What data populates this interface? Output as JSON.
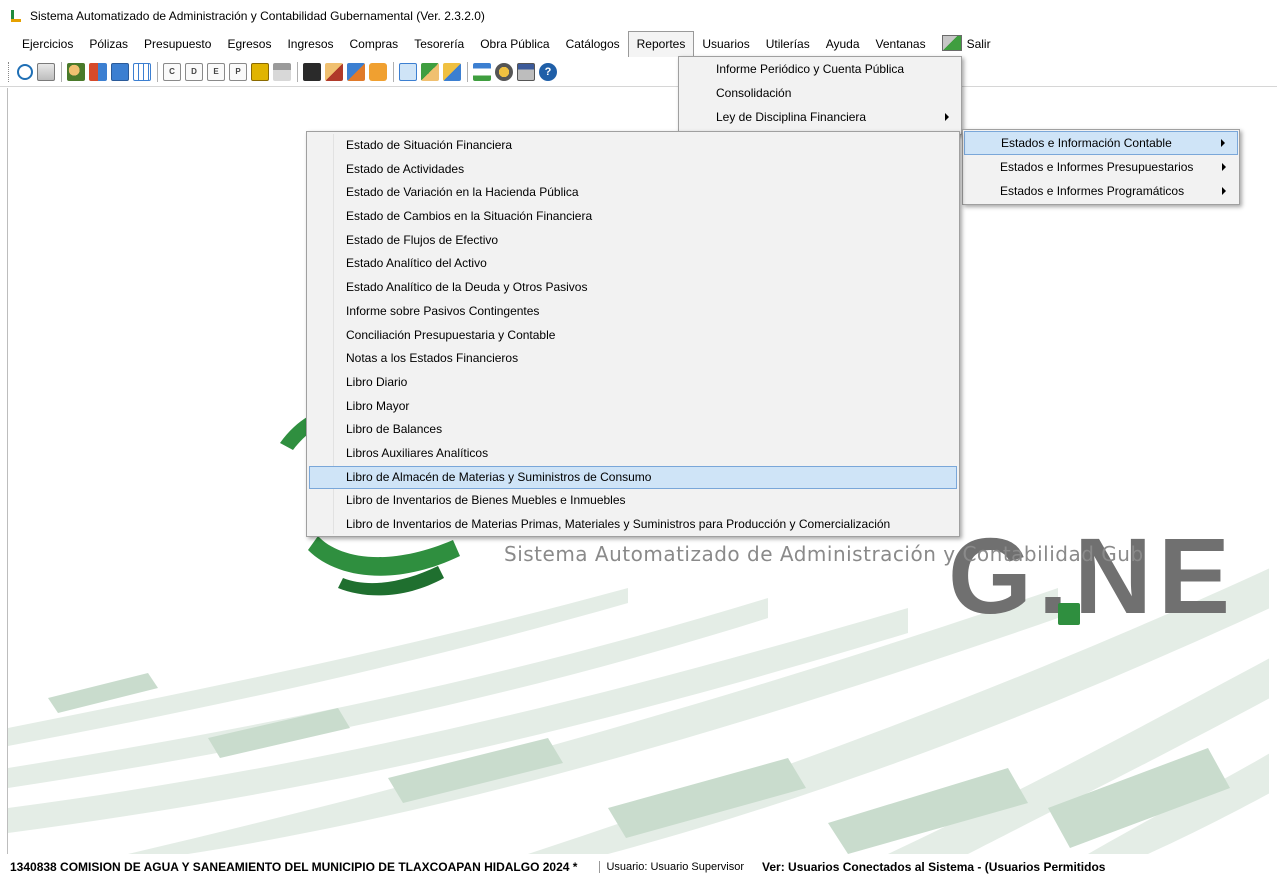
{
  "window": {
    "title": "Sistema Automatizado de Administración y Contabilidad Gubernamental  (Ver. 2.3.2.0)"
  },
  "menubar": {
    "items": [
      "Ejercicios",
      "Pólizas",
      "Presupuesto",
      "Egresos",
      "Ingresos",
      "Compras",
      "Tesorería",
      "Obra Pública",
      "Catálogos",
      "Reportes",
      "Usuarios",
      "Utilerías",
      "Ayuda",
      "Ventanas"
    ],
    "exit_label": "Salir",
    "active": "Reportes"
  },
  "toolbar": {
    "letter_buttons": [
      "C",
      "D",
      "E",
      "P"
    ]
  },
  "reportes_menu": {
    "items": [
      "Informe Periódico y Cuenta Pública",
      "Consolidación",
      "Ley de Disciplina Financiera",
      ""
    ]
  },
  "contable_submenu": {
    "items": [
      "Estados e Información Contable",
      "Estados e Informes Presupuestarios",
      "Estados e Informes Programáticos"
    ],
    "highlighted_index": 0
  },
  "estados_menu": {
    "items": [
      "Estado de Situación Financiera",
      "Estado de Actividades",
      "Estado de Variación en la Hacienda Pública",
      "Estado de Cambios en la Situación Financiera",
      "Estado de Flujos de Efectivo",
      "Estado Analítico del Activo",
      "Estado Analítico de la Deuda y Otros Pasivos",
      "Informe sobre Pasivos Contingentes",
      "Conciliación Presupuestaria y Contable",
      "Notas a los Estados Financieros",
      "Libro Diario",
      "Libro Mayor",
      "Libro de Balances",
      "Libros Auxiliares Analíticos",
      "Libro de Almacén de Materias y Suministros de Consumo",
      "Libro de Inventarios de Bienes Muebles e Inmuebles",
      "Libro de Inventarios de Materias Primas, Materiales y Suministros para Producción y Comercialización"
    ],
    "highlighted_index": 14
  },
  "background_logo": {
    "letters": "G.NE",
    "subtitle": "Sistema Automatizado de Administración y Contabilidad Gub",
    "accent_color": "#2f8f3f"
  },
  "statusbar": {
    "organization": "1340838 COMISION DE AGUA Y SANEAMIENTO DEL MUNICIPIO DE TLAXCOAPAN HIDALGO  2024  *",
    "user": "Usuario: Usuario Supervisor",
    "connected": "Ver: Usuarios Conectados al Sistema - (Usuarios Permitidos"
  }
}
